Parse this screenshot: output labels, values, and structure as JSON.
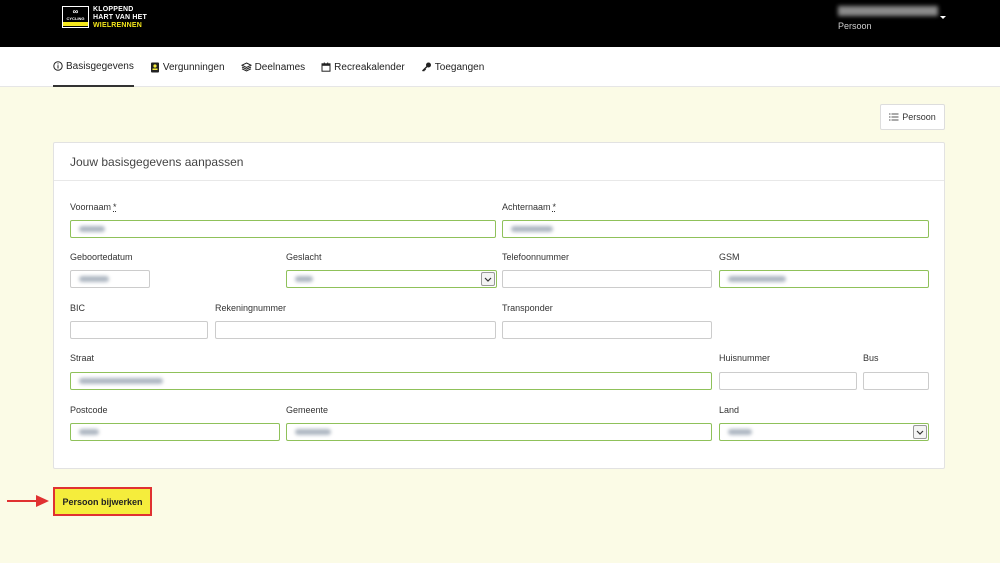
{
  "header": {
    "logo": {
      "mark_text": "CYCLING",
      "mark_subtext": "VLAANDEREN",
      "line1": "KLOPPEND",
      "line2": "HART VAN HET",
      "line3": "WIELRENNEN"
    },
    "user_role": "Persoon"
  },
  "nav": {
    "tabs": [
      {
        "label": "Basisgegevens",
        "icon": "info-icon",
        "active": true
      },
      {
        "label": "Vergunningen",
        "icon": "id-card-icon",
        "active": false
      },
      {
        "label": "Deelnames",
        "icon": "layers-icon",
        "active": false
      },
      {
        "label": "Recreakalender",
        "icon": "calendar-icon",
        "active": false
      },
      {
        "label": "Toegangen",
        "icon": "key-icon",
        "active": false
      }
    ]
  },
  "toolbar": {
    "persoon_button": "Persoon"
  },
  "form": {
    "title": "Jouw basisgegevens aanpassen",
    "required_mark": "*",
    "voornaam": {
      "label": "Voornaam"
    },
    "achternaam": {
      "label": "Achternaam"
    },
    "geboortedatum": {
      "label": "Geboortedatum"
    },
    "geslacht": {
      "label": "Geslacht"
    },
    "telefoonnummer": {
      "label": "Telefoonnummer"
    },
    "gsm": {
      "label": "GSM"
    },
    "bic": {
      "label": "BIC"
    },
    "rekeningnummer": {
      "label": "Rekeningnummer"
    },
    "transponder": {
      "label": "Transponder"
    },
    "straat": {
      "label": "Straat"
    },
    "huisnummer": {
      "label": "Huisnummer"
    },
    "bus": {
      "label": "Bus"
    },
    "postcode": {
      "label": "Postcode"
    },
    "gemeente": {
      "label": "Gemeente"
    },
    "land": {
      "label": "Land"
    }
  },
  "submit": {
    "label": "Persoon bijwerken"
  },
  "colors": {
    "accent_yellow": "#f5ed3c",
    "valid_border": "#8fc15a",
    "annotation_red": "#e03131",
    "background": "#fbfbe6"
  }
}
